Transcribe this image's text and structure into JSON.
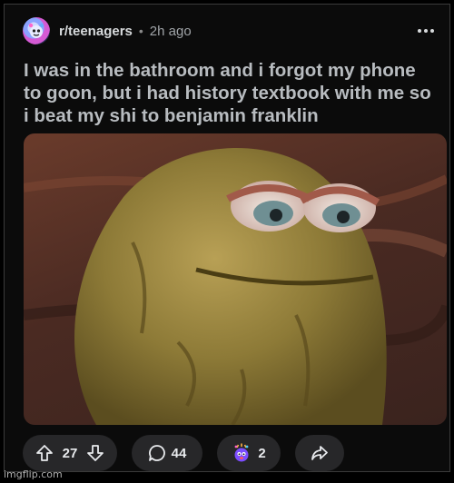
{
  "post": {
    "subreddit": "r/teenagers",
    "separator": "•",
    "time": "2h ago",
    "title": "I was in the bathroom and i forgot my phone to goon, but i had history textbook with me so i beat my shi to benjamin franklin",
    "image_description_icon": "dried-pepe-frog-meme-image"
  },
  "actions": {
    "upvote_icon": "arrow-up-icon",
    "score": "27",
    "downvote_icon": "arrow-down-icon",
    "comment_icon": "speech-bubble-icon",
    "comments": "44",
    "award_icon": "mind-blown-award-icon",
    "awards": "2",
    "share_icon": "share-arrow-icon"
  },
  "watermark": "imgflip.com",
  "colors": {
    "background": "#0b0b0b",
    "pill": "#272729",
    "text": "#d7dadc",
    "muted": "#a0a4a8"
  }
}
